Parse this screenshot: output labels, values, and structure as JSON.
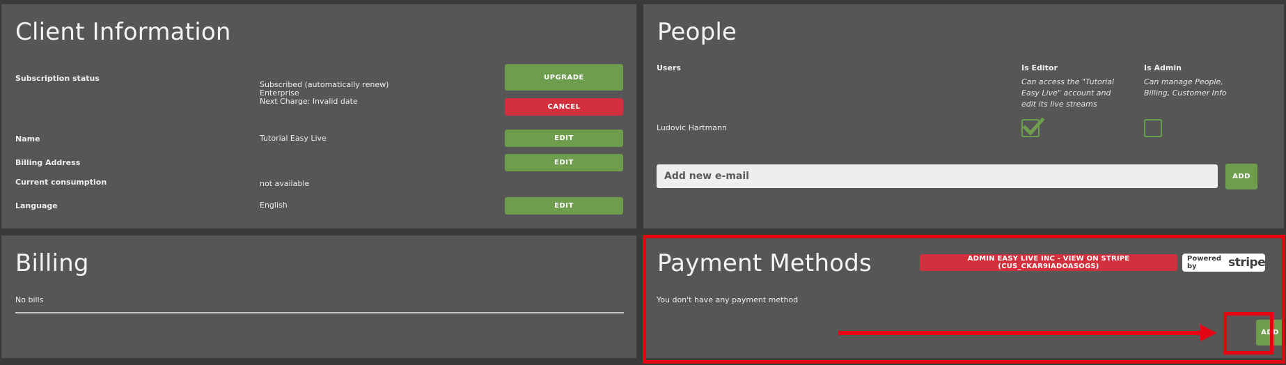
{
  "client": {
    "title": "Client Information",
    "subscription_label": "Subscription status",
    "subscription_line1": "Subscribed (automatically renew)",
    "subscription_line2": "Enterprise",
    "subscription_line3": "Next Charge: Invalid date",
    "upgrade_label": "UPGRADE",
    "cancel_label": "CANCEL",
    "name_label": "Name",
    "name_value": "Tutorial Easy Live",
    "billing_address_label": "Billing Address",
    "consumption_label": "Current consumption",
    "consumption_value": "not available",
    "language_label": "Language",
    "language_value": "English",
    "edit_label": "EDIT"
  },
  "people": {
    "title": "People",
    "users_header": "Users",
    "editor_header": "Is Editor",
    "editor_desc": "Can access the \"Tutorial Easy Live\" account and edit its live streams",
    "admin_header": "Is Admin",
    "admin_desc": "Can manage People, Billing, Customer Info",
    "users": [
      {
        "name": "Ludovic Hartmann",
        "is_editor": true,
        "is_admin": false
      }
    ],
    "email_placeholder": "Add new e-mail",
    "add_label": "ADD"
  },
  "billing": {
    "title": "Billing",
    "empty_text": "No bills"
  },
  "payment": {
    "title": "Payment Methods",
    "stripe_link": "ADMIN EASY LIVE INC - VIEW ON STRIPE (CUS_CKAR9IADOASOGS)",
    "powered_by": "Powered by",
    "stripe_logo": "stripe",
    "empty_text": "You don't have any payment method",
    "add_label": "ADD"
  },
  "colors": {
    "panel_bg": "#565656",
    "page_bg": "#3a3a3a",
    "green": "#6f9d4e",
    "red": "#d2303c",
    "annotation_red": "#e30612"
  }
}
